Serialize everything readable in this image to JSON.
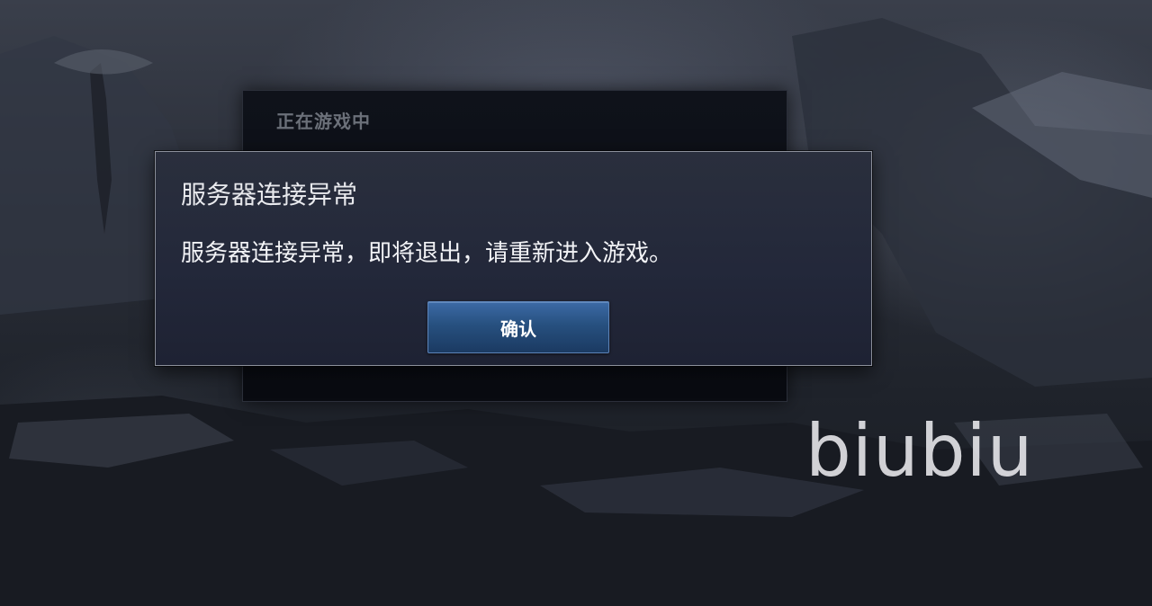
{
  "background_panel": {
    "title": "正在游戏中"
  },
  "dialog": {
    "title": "服务器连接异常",
    "message": "服务器连接异常，即将退出，请重新进入游戏。",
    "confirm_label": "确认"
  },
  "watermark": {
    "text": "biubiu"
  }
}
